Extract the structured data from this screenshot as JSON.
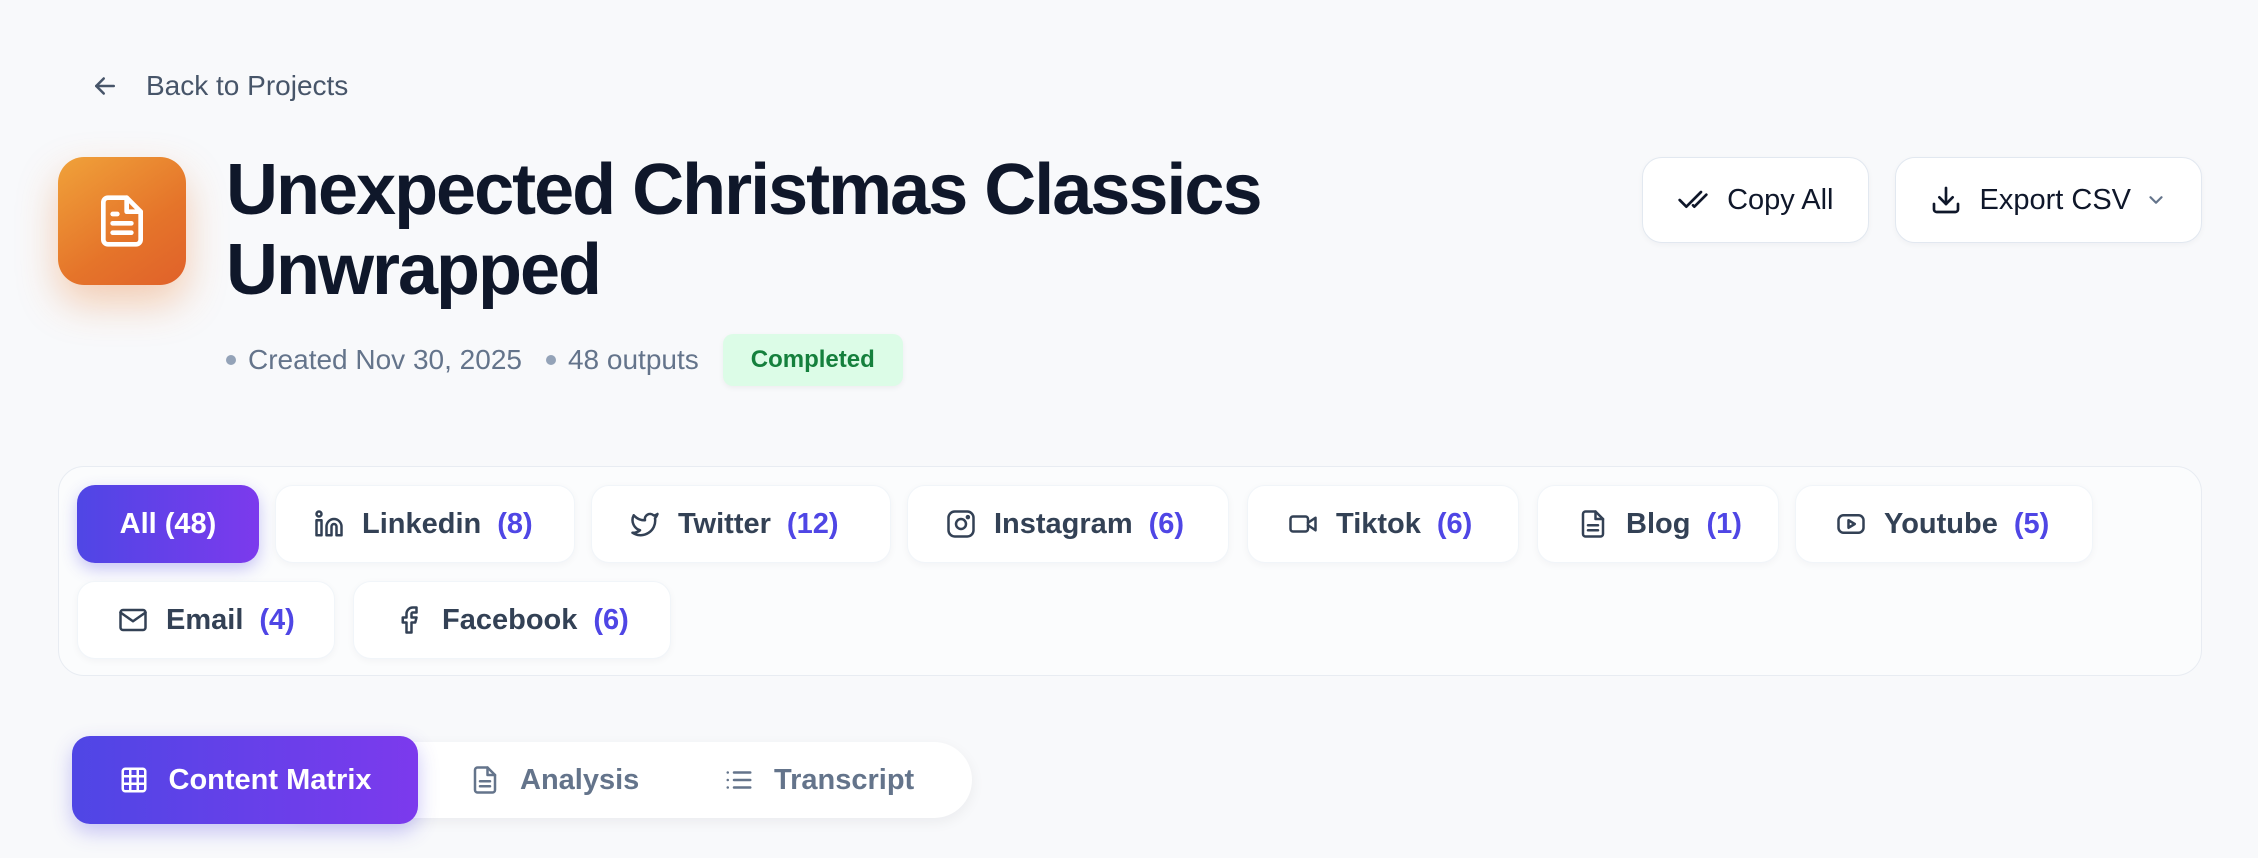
{
  "nav": {
    "back_label": "Back to Projects"
  },
  "project": {
    "icon": "document-icon",
    "title_line1": "Unexpected Christmas Classics",
    "title_line2": "Unwrapped",
    "created": "Created Nov 30, 2025",
    "outputs": "48 outputs",
    "status": "Completed"
  },
  "actions": {
    "copy_all": "Copy All",
    "export_csv": "Export CSV"
  },
  "filters": [
    {
      "label": "All (48)",
      "count": "",
      "icon": ""
    },
    {
      "label": "Linkedin",
      "count": "(8)",
      "icon": "linkedin-icon"
    },
    {
      "label": "Twitter",
      "count": "(12)",
      "icon": "twitter-icon"
    },
    {
      "label": "Instagram",
      "count": "(6)",
      "icon": "instagram-icon"
    },
    {
      "label": "Tiktok",
      "count": "(6)",
      "icon": "video-icon"
    },
    {
      "label": "Blog",
      "count": "(1)",
      "icon": "document-icon"
    },
    {
      "label": "Youtube",
      "count": "(5)",
      "icon": "youtube-icon"
    },
    {
      "label": "Email",
      "count": "(4)",
      "icon": "mail-icon"
    },
    {
      "label": "Facebook",
      "count": "(6)",
      "icon": "facebook-icon"
    }
  ],
  "tabs": [
    {
      "label": "Content Matrix",
      "icon": "grid-icon",
      "active": true
    },
    {
      "label": "Analysis",
      "icon": "document-icon"
    },
    {
      "label": "Transcript",
      "icon": "list-icon"
    }
  ],
  "colors": {
    "accent": "#4f46e5",
    "accent_end": "#7c3aed",
    "icon_orange": "#e5742a",
    "status_bg": "#dcfce7",
    "status_text": "#15803d"
  }
}
